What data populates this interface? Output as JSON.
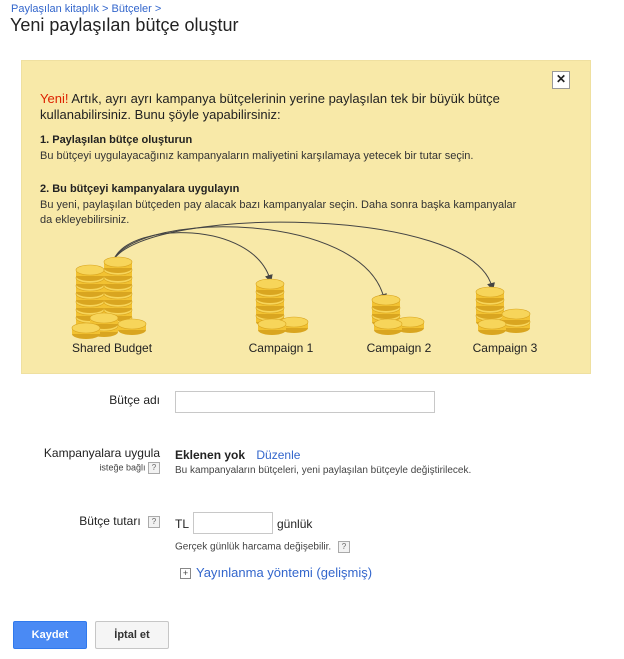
{
  "breadcrumb": {
    "items": [
      "Paylaşılan kitaplık",
      "Bütçeler"
    ],
    "separator": ">"
  },
  "page_title": "Yeni paylaşılan bütçe oluştur",
  "promo": {
    "close_label": "✕",
    "new_label": "Yeni!",
    "intro_text": "Artık, ayrı ayrı kampanya bütçelerinin yerine paylaşılan tek bir büyük bütçe kullanabilirsiniz. Bunu şöyle yapabilirsiniz:",
    "step1_title": "1. Paylaşılan bütçe oluşturun",
    "step1_text": "Bu bütçeyi uygulayacağınız kampanyaların maliyetini karşılamaya yetecek bir tutar seçin.",
    "step2_title": "2. Bu bütçeyi kampanyalara uygulayın",
    "step2_text": "Bu yeni, paylaşılan bütçeden pay alacak bazı kampanyalar seçin. Daha sonra başka kampanyalar da ekleyebilirsiniz.",
    "diagram_labels": [
      "Shared Budget",
      "Campaign 1",
      "Campaign 2",
      "Campaign 3"
    ],
    "colors": {
      "background": "#f8e9a8",
      "coin": "#f2c232",
      "coin_dark": "#d9a520",
      "new": "#dd2200"
    }
  },
  "form": {
    "budget_name_label": "Bütçe adı",
    "budget_name_value": "",
    "apply_label": "Kampanyalara uygula",
    "apply_sub": "isteğe bağlı",
    "apply_value": "Eklenen yok",
    "apply_edit_link": "Düzenle",
    "apply_note": "Bu kampanyaların bütçeleri, yeni paylaşılan bütçeyle değiştirilecek.",
    "amount_label": "Bütçe tutarı",
    "currency": "TL",
    "amount_value": "",
    "amount_suffix": "günlük",
    "amount_note": "Gerçek günlük harcama değişebilir.",
    "delivery_link": "Yayınlanma yöntemi (gelişmiş)",
    "help_glyph": "?",
    "expand_glyph": "+"
  },
  "buttons": {
    "save": "Kaydet",
    "cancel": "İptal et"
  }
}
